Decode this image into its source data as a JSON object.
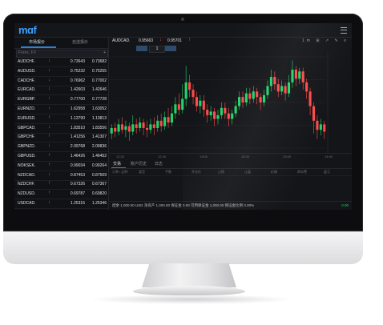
{
  "app": {
    "logo": "mɑf"
  },
  "left_panel": {
    "tabs": [
      "市场报价",
      "自选报价"
    ],
    "search_placeholder": "Forex, FX",
    "add_symbol": "+",
    "quotes": [
      {
        "symbol": "AUDCHF.",
        "dir": "down",
        "bid": "0.73643",
        "ask": "0.73682"
      },
      {
        "symbol": "AUDUSD.",
        "dir": "down",
        "bid": "0.75232",
        "ask": "0.75255"
      },
      {
        "symbol": "CADCHF.",
        "dir": "down",
        "bid": "0.76962",
        "ask": "0.77002"
      },
      {
        "symbol": "EURCAD.",
        "dir": "down",
        "bid": "1.42603",
        "ask": "1.42646"
      },
      {
        "symbol": "EURGBP.",
        "dir": "down",
        "bid": "0.77700",
        "ask": "0.77728"
      },
      {
        "symbol": "EURNZD.",
        "dir": "down",
        "bid": "1.62958",
        "ask": "1.63052"
      },
      {
        "symbol": "EURUSD.",
        "dir": "up",
        "bid": "1.13790",
        "ask": "1.13813"
      },
      {
        "symbol": "GBPCAD.",
        "dir": "down",
        "bid": "1.83510",
        "ask": "1.83556"
      },
      {
        "symbol": "GBPCHF.",
        "dir": "up",
        "bid": "1.41256",
        "ask": "1.41307"
      },
      {
        "symbol": "GBPNZD.",
        "dir": "down",
        "bid": "2.09768",
        "ask": "2.09836"
      },
      {
        "symbol": "GBPUSD.",
        "dir": "up",
        "bid": "1.46426",
        "ask": "1.46452"
      },
      {
        "symbol": "NOKSEK.",
        "dir": "up",
        "bid": "0.99034",
        "ask": "0.99264"
      },
      {
        "symbol": "NZDCAD.",
        "dir": "down",
        "bid": "0.87453",
        "ask": "0.87509"
      },
      {
        "symbol": "NZDCHF.",
        "dir": "up",
        "bid": "0.67326",
        "ask": "0.67367"
      },
      {
        "symbol": "NZDUSD.",
        "dir": "up",
        "bid": "0.69787",
        "ask": "0.69820"
      },
      {
        "symbol": "USDCAD.",
        "dir": "down",
        "bid": "1.25315",
        "ask": "1.25346"
      }
    ]
  },
  "chart_header": {
    "symbol": "AUDCAD.",
    "bid": "0.95663",
    "ask": "0.95701",
    "tools": "1m ⊞ ↗ ✎ ≡"
  },
  "volume_control": {
    "value": "1"
  },
  "chart_data": {
    "type": "candlestick",
    "candles": [
      [
        0.9548,
        0.9551,
        0.9545,
        0.9553
      ],
      [
        0.9551,
        0.9549,
        0.9546,
        0.9554
      ],
      [
        0.9549,
        0.9553,
        0.9547,
        0.9556
      ],
      [
        0.9553,
        0.955,
        0.9548,
        0.9557
      ],
      [
        0.955,
        0.9552,
        0.9546,
        0.9555
      ],
      [
        0.9552,
        0.9549,
        0.9544,
        0.9554
      ],
      [
        0.9549,
        0.9553,
        0.9547,
        0.9558
      ],
      [
        0.9553,
        0.9551,
        0.9548,
        0.9556
      ],
      [
        0.9551,
        0.9554,
        0.9549,
        0.9557
      ],
      [
        0.9554,
        0.9551,
        0.9547,
        0.9556
      ],
      [
        0.9551,
        0.955,
        0.9546,
        0.9555
      ],
      [
        0.955,
        0.9553,
        0.9548,
        0.9556
      ],
      [
        0.9553,
        0.9551,
        0.9547,
        0.9557
      ],
      [
        0.9551,
        0.9555,
        0.9549,
        0.9558
      ],
      [
        0.9555,
        0.9552,
        0.9549,
        0.9559
      ],
      [
        0.9552,
        0.9557,
        0.955,
        0.956
      ],
      [
        0.9557,
        0.9554,
        0.9551,
        0.9562
      ],
      [
        0.9554,
        0.9559,
        0.9552,
        0.9563
      ],
      [
        0.9559,
        0.9564,
        0.9556,
        0.9568
      ],
      [
        0.9564,
        0.9561,
        0.9558,
        0.957
      ],
      [
        0.9561,
        0.9567,
        0.9559,
        0.9575
      ],
      [
        0.9567,
        0.9576,
        0.9563,
        0.9585
      ],
      [
        0.9576,
        0.9572,
        0.9568,
        0.958
      ],
      [
        0.9572,
        0.9568,
        0.9564,
        0.9575
      ],
      [
        0.9568,
        0.9563,
        0.956,
        0.9571
      ],
      [
        0.9563,
        0.9566,
        0.9559,
        0.9569
      ],
      [
        0.9566,
        0.9561,
        0.9557,
        0.9569
      ],
      [
        0.9561,
        0.9558,
        0.9554,
        0.9564
      ],
      [
        0.9558,
        0.956,
        0.9555,
        0.9563
      ],
      [
        0.956,
        0.9556,
        0.9552,
        0.9562
      ],
      [
        0.9556,
        0.9558,
        0.9553,
        0.9561
      ],
      [
        0.9558,
        0.9562,
        0.9556,
        0.9565
      ],
      [
        0.9562,
        0.9559,
        0.9556,
        0.9565
      ],
      [
        0.9559,
        0.9556,
        0.9552,
        0.9562
      ],
      [
        0.9556,
        0.9559,
        0.9553,
        0.9561
      ],
      [
        0.9559,
        0.9563,
        0.9557,
        0.9566
      ],
      [
        0.9563,
        0.9568,
        0.9561,
        0.9571
      ],
      [
        0.9568,
        0.9565,
        0.9562,
        0.9571
      ],
      [
        0.9565,
        0.957,
        0.9563,
        0.9573
      ],
      [
        0.957,
        0.9567,
        0.9564,
        0.9573
      ],
      [
        0.9567,
        0.9571,
        0.9565,
        0.9574
      ],
      [
        0.9571,
        0.9568,
        0.9564,
        0.9573
      ],
      [
        0.9568,
        0.9565,
        0.9561,
        0.957
      ],
      [
        0.9565,
        0.9569,
        0.9563,
        0.9572
      ],
      [
        0.9569,
        0.9574,
        0.9567,
        0.9577
      ],
      [
        0.9574,
        0.9579,
        0.9571,
        0.9583
      ],
      [
        0.9579,
        0.9575,
        0.9572,
        0.9582
      ],
      [
        0.9575,
        0.9571,
        0.9568,
        0.9578
      ],
      [
        0.9571,
        0.9574,
        0.9569,
        0.9577
      ],
      [
        0.9574,
        0.957,
        0.9566,
        0.9576
      ],
      [
        0.957,
        0.9576,
        0.9568,
        0.958
      ],
      [
        0.9576,
        0.9583,
        0.9573,
        0.9588
      ],
      [
        0.9583,
        0.9578,
        0.9574,
        0.9585
      ],
      [
        0.9578,
        0.9582,
        0.9575,
        0.9584
      ],
      [
        0.9582,
        0.9576,
        0.9572,
        0.9584
      ],
      [
        0.9576,
        0.9571,
        0.9567,
        0.9578
      ],
      [
        0.9571,
        0.9563,
        0.9558,
        0.9573
      ],
      [
        0.9563,
        0.9555,
        0.9548,
        0.9565
      ],
      [
        0.9555,
        0.955,
        0.9545,
        0.9558
      ],
      [
        0.955,
        0.9553,
        0.9547,
        0.9556
      ],
      [
        0.9553,
        0.9549,
        0.9545,
        0.9555
      ]
    ],
    "ylim": [
      0.954,
      0.959
    ],
    "grid": true
  },
  "x_ticks": [
    "12:20",
    "12:40",
    "13:00",
    "13:20",
    "13:40",
    "14:00"
  ],
  "bottom_panel": {
    "tabs": [
      "交易",
      "账户历史",
      "日志"
    ],
    "columns": [
      "订单 / 品种",
      "类型",
      "手数",
      "开仓价",
      "止损",
      "止盈",
      "价格",
      "库存费",
      "盈亏"
    ],
    "status_text": "结余 1,000.00 USD  净资产 1,000.00  保证金 0.00  可用保证金 1,000.00  保证金比例 0.00%",
    "pnl": "0.00"
  },
  "colors": {
    "up": "#22d36a",
    "down": "#ff4a4a",
    "accent": "#2f7fd6"
  }
}
